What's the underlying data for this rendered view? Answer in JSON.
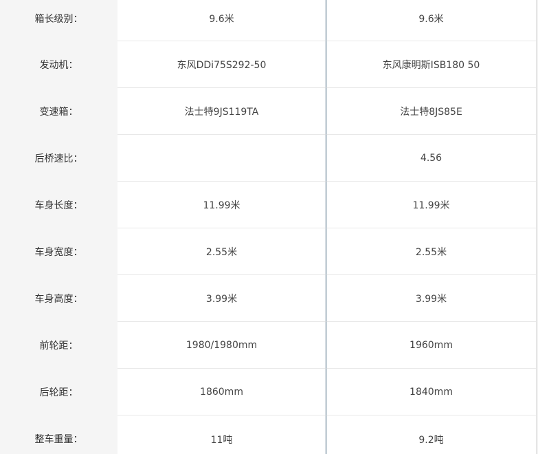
{
  "rows": [
    {
      "label": "箱长级别：",
      "a": "9.6米",
      "b": "9.6米"
    },
    {
      "label": "发动机：",
      "a": "东风DDi75S292-50",
      "b": "东风康明斯ISB180 50"
    },
    {
      "label": "变速箱：",
      "a": "法士特9JS119TA",
      "b": "法士特8JS85E"
    },
    {
      "label": "后桥速比：",
      "a": "",
      "b": "4.56"
    },
    {
      "label": "车身长度：",
      "a": "11.99米",
      "b": "11.99米"
    },
    {
      "label": "车身宽度：",
      "a": "2.55米",
      "b": "2.55米"
    },
    {
      "label": "车身高度：",
      "a": "3.99米",
      "b": "3.99米"
    },
    {
      "label": "前轮距：",
      "a": "1980/1980mm",
      "b": "1960mm"
    },
    {
      "label": "后轮距：",
      "a": "1860mm",
      "b": "1840mm"
    },
    {
      "label": "整车重量：",
      "a": "11吨",
      "b": "9.2吨"
    }
  ]
}
